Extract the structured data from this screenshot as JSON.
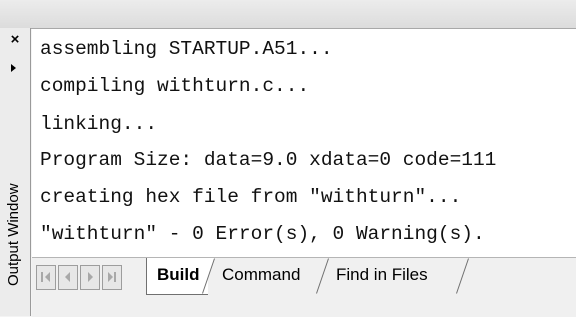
{
  "window": {
    "title": "Output Window",
    "close_glyph": "×"
  },
  "output": {
    "lines": [
      "assembling STARTUP.A51...",
      "compiling withturn.c...",
      "linking...",
      "Program Size: data=9.0 xdata=0 code=111",
      "creating hex file from \"withturn\"...",
      "\"withturn\" - 0 Error(s), 0 Warning(s)."
    ]
  },
  "tabs": [
    {
      "label": "Build",
      "active": true
    },
    {
      "label": "Command",
      "active": false
    },
    {
      "label": "Find in Files",
      "active": false
    }
  ],
  "nav_buttons": [
    "first-icon",
    "previous-icon",
    "next-icon",
    "last-icon"
  ],
  "colors": {
    "pane_background": "#ffffff",
    "chrome_background": "#f0f0f0",
    "text": "#111111"
  }
}
